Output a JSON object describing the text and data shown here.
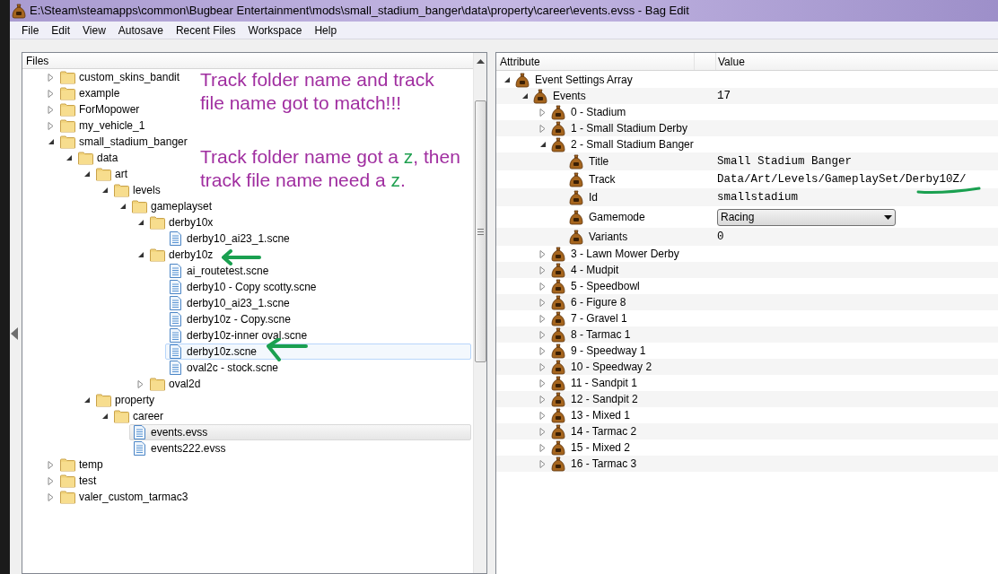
{
  "window": {
    "title": "E:\\Steam\\steamapps\\common\\Bugbear Entertainment\\mods\\small_stadium_banger\\data\\property\\career\\events.evss - Bag Edit"
  },
  "menu": [
    "File",
    "Edit",
    "View",
    "Autosave",
    "Recent Files",
    "Workspace",
    "Help"
  ],
  "files_panel": {
    "header": "Files",
    "tree": [
      {
        "kind": "folder",
        "label": "custom_skins_bandit",
        "expanded": false,
        "selected": false,
        "hovered": false
      },
      {
        "kind": "folder",
        "label": "example",
        "expanded": false,
        "selected": false,
        "hovered": false
      },
      {
        "kind": "folder",
        "label": "ForMopower",
        "expanded": false,
        "selected": false,
        "hovered": false
      },
      {
        "kind": "folder",
        "label": "my_vehicle_1",
        "expanded": false,
        "selected": false,
        "hovered": false
      },
      {
        "kind": "folder",
        "label": "small_stadium_banger",
        "expanded": true,
        "selected": false,
        "hovered": false,
        "children": [
          {
            "kind": "folder",
            "label": "data",
            "expanded": true,
            "selected": false,
            "hovered": false,
            "children": [
              {
                "kind": "folder",
                "label": "art",
                "expanded": true,
                "selected": false,
                "hovered": false,
                "children": [
                  {
                    "kind": "folder",
                    "label": "levels",
                    "expanded": true,
                    "selected": false,
                    "hovered": false,
                    "children": [
                      {
                        "kind": "folder",
                        "label": "gameplayset",
                        "expanded": true,
                        "selected": false,
                        "hovered": false,
                        "children": [
                          {
                            "kind": "folder",
                            "label": "derby10x",
                            "expanded": true,
                            "selected": false,
                            "hovered": false,
                            "children": [
                              {
                                "kind": "file",
                                "label": "derby10_ai23_1.scne",
                                "selected": false,
                                "hovered": false
                              }
                            ]
                          },
                          {
                            "kind": "folder",
                            "label": "derby10z",
                            "expanded": true,
                            "selected": false,
                            "hovered": false,
                            "children": [
                              {
                                "kind": "file",
                                "label": "ai_routetest.scne",
                                "selected": false,
                                "hovered": false
                              },
                              {
                                "kind": "file",
                                "label": "derby10 - Copy scotty.scne",
                                "selected": false,
                                "hovered": false
                              },
                              {
                                "kind": "file",
                                "label": "derby10_ai23_1.scne",
                                "selected": false,
                                "hovered": false
                              },
                              {
                                "kind": "file",
                                "label": "derby10z - Copy.scne",
                                "selected": false,
                                "hovered": false
                              },
                              {
                                "kind": "file",
                                "label": "derby10z-inner oval.scne",
                                "selected": false,
                                "hovered": false
                              },
                              {
                                "kind": "file",
                                "label": "derby10z.scne",
                                "selected": false,
                                "hovered": true
                              },
                              {
                                "kind": "file",
                                "label": "oval2c - stock.scne",
                                "selected": false,
                                "hovered": false
                              }
                            ]
                          },
                          {
                            "kind": "folder",
                            "label": "oval2d",
                            "expanded": false,
                            "selected": false,
                            "hovered": false
                          }
                        ]
                      }
                    ]
                  }
                ]
              },
              {
                "kind": "folder",
                "label": "property",
                "expanded": true,
                "selected": false,
                "hovered": false,
                "children": [
                  {
                    "kind": "folder",
                    "label": "career",
                    "expanded": true,
                    "selected": false,
                    "hovered": false,
                    "children": [
                      {
                        "kind": "file",
                        "label": "events.evss",
                        "selected": true,
                        "hovered": false
                      },
                      {
                        "kind": "file",
                        "label": "events222.evss",
                        "selected": false,
                        "hovered": false
                      }
                    ]
                  }
                ]
              }
            ]
          }
        ]
      },
      {
        "kind": "folder",
        "label": "temp",
        "expanded": false,
        "selected": false,
        "hovered": false
      },
      {
        "kind": "folder",
        "label": "test",
        "expanded": false,
        "selected": false,
        "hovered": false
      },
      {
        "kind": "folder",
        "label": "valer_custom_tarmac3",
        "expanded": false,
        "selected": false,
        "hovered": false
      }
    ]
  },
  "annotations": [
    {
      "lines": [
        [
          {
            "text": "Track folder name and track",
            "accent": false
          }
        ],
        [
          {
            "text": "file name got to match!!!",
            "accent": false
          }
        ]
      ]
    },
    {
      "lines": [
        [
          {
            "text": "Track folder name got a ",
            "accent": false
          },
          {
            "text": "z",
            "accent": true
          },
          {
            "text": ", then",
            "accent": false
          }
        ],
        [
          {
            "text": "track file name need a ",
            "accent": false
          },
          {
            "text": "z",
            "accent": true
          },
          {
            "text": ".",
            "accent": false
          }
        ]
      ]
    }
  ],
  "properties_panel": {
    "columns": [
      "Attribute",
      "Value"
    ],
    "tree": [
      {
        "kind": "node",
        "label": "Event Settings Array",
        "expanded": true,
        "children": [
          {
            "kind": "node",
            "label": "Events",
            "value": "17",
            "expanded": true,
            "children": [
              {
                "kind": "node",
                "label": "0 - Stadium",
                "expanded": false
              },
              {
                "kind": "node",
                "label": "1 - Small Stadium Derby",
                "expanded": false
              },
              {
                "kind": "node",
                "label": "2 - Small Stadium Banger",
                "expanded": true,
                "children": [
                  {
                    "kind": "text",
                    "label": "Title",
                    "value": "Small Stadium Banger"
                  },
                  {
                    "kind": "text",
                    "label": "Track",
                    "value": "Data/Art/Levels/GameplaySet/Derby10Z/"
                  },
                  {
                    "kind": "text",
                    "label": "Id",
                    "value": "smallstadium"
                  },
                  {
                    "kind": "dropdown",
                    "label": "Gamemode",
                    "value": "Racing"
                  },
                  {
                    "kind": "number",
                    "label": "Variants",
                    "value": "0"
                  }
                ]
              },
              {
                "kind": "node",
                "label": "3 - Lawn Mower Derby",
                "expanded": false
              },
              {
                "kind": "node",
                "label": "4 - Mudpit",
                "expanded": false
              },
              {
                "kind": "node",
                "label": "5 - Speedbowl",
                "expanded": false
              },
              {
                "kind": "node",
                "label": "6 - Figure 8",
                "expanded": false
              },
              {
                "kind": "node",
                "label": "7 - Gravel 1",
                "expanded": false
              },
              {
                "kind": "node",
                "label": "8 - Tarmac 1",
                "expanded": false
              },
              {
                "kind": "node",
                "label": "9 - Speedway 1",
                "expanded": false
              },
              {
                "kind": "node",
                "label": "10 - Speedway 2",
                "expanded": false
              },
              {
                "kind": "node",
                "label": "11 - Sandpit 1",
                "expanded": false
              },
              {
                "kind": "node",
                "label": "12 - Sandpit 2",
                "expanded": false
              },
              {
                "kind": "node",
                "label": "13 - Mixed 1",
                "expanded": false
              },
              {
                "kind": "node",
                "label": "14 - Tarmac 2",
                "expanded": false
              },
              {
                "kind": "node",
                "label": "15 - Mixed 2",
                "expanded": false
              },
              {
                "kind": "node",
                "label": "16 - Tarmac 3",
                "expanded": false
              }
            ]
          }
        ]
      }
    ]
  }
}
